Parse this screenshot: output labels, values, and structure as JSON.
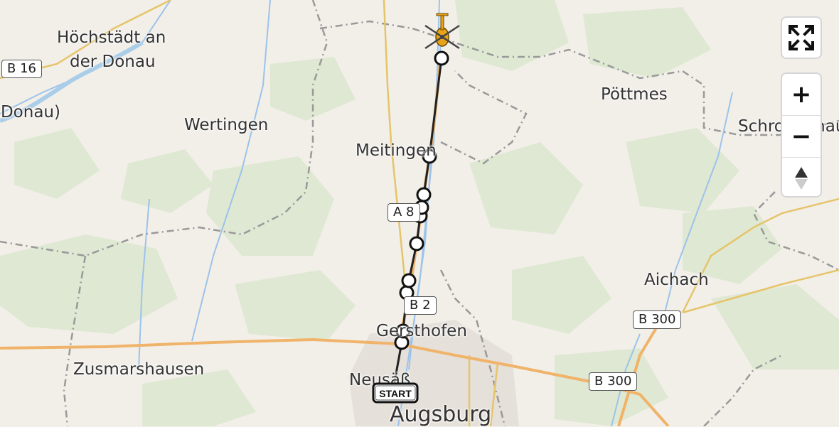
{
  "places": [
    {
      "id": "hoechstaedt-1",
      "text": "Höchstädt an"
    },
    {
      "id": "hoechstaedt-2",
      "text": "der Donau"
    },
    {
      "id": "donau",
      "text": "(Donau)"
    },
    {
      "id": "wertingen",
      "text": "Wertingen"
    },
    {
      "id": "meitingen",
      "text": "Meitingen"
    },
    {
      "id": "poettmes",
      "text": "Pöttmes"
    },
    {
      "id": "schrobenhausen",
      "text": "Schrobenhausen"
    },
    {
      "id": "aichach",
      "text": "Aichach"
    },
    {
      "id": "gersthofen",
      "text": "Gersthofen"
    },
    {
      "id": "zusmarshausen",
      "text": "Zusmarshausen"
    },
    {
      "id": "neusaess",
      "text": "Neusäß"
    },
    {
      "id": "augsburg",
      "text": "Augsburg"
    }
  ],
  "road_shields": [
    {
      "id": "b16",
      "text": "B 16"
    },
    {
      "id": "a8",
      "text": "A 8"
    },
    {
      "id": "b2",
      "text": "B 2"
    },
    {
      "id": "b300-north",
      "text": "B 300"
    },
    {
      "id": "b300-south",
      "text": "B 300"
    }
  ],
  "route": {
    "start_label": "START",
    "waypoint_count": 11,
    "line_color": "#222222",
    "vehicle_icon": "helicopter-icon",
    "vehicle_color": "#e8a317"
  },
  "controls": {
    "fullscreen_icon": "fullscreen-icon",
    "zoom_in_label": "+",
    "zoom_out_label": "−",
    "compass_icon": "compass-icon"
  }
}
